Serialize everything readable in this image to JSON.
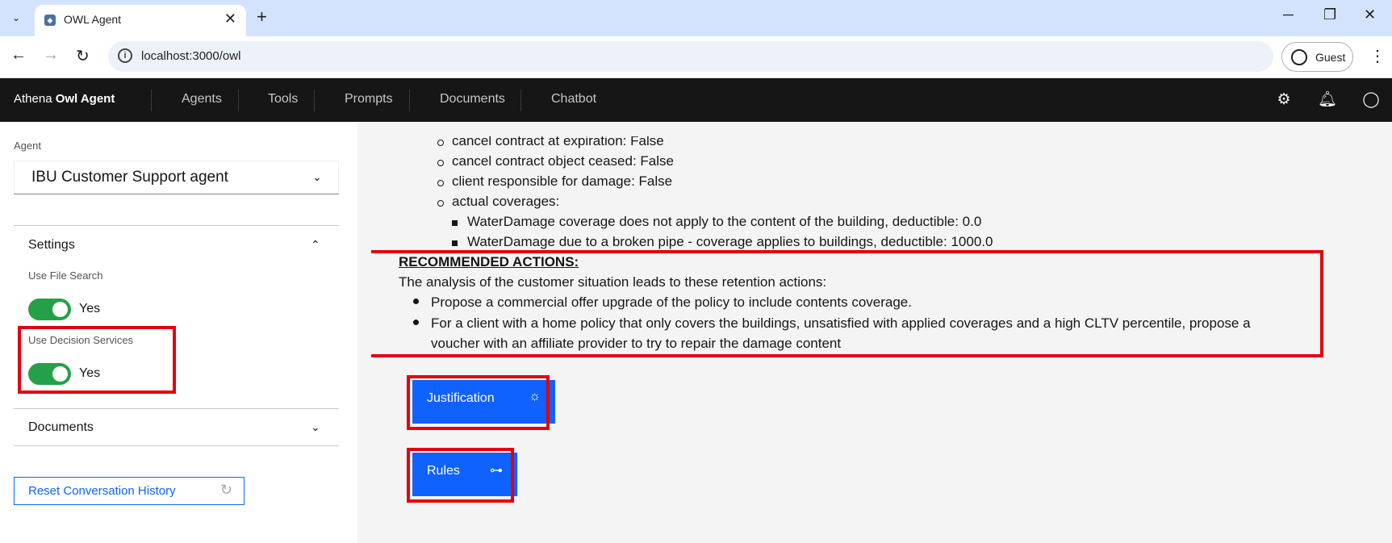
{
  "browser": {
    "tab_title": "OWL Agent",
    "url": "localhost:3000/owl",
    "profile_label": "Guest"
  },
  "header": {
    "brand_prefix": "Athena",
    "brand_bold": "Owl Agent",
    "nav": [
      "Agents",
      "Tools",
      "Prompts",
      "Documents",
      "Chatbot"
    ]
  },
  "sidebar": {
    "agent_label": "Agent",
    "agent_value": "IBU Customer Support agent",
    "settings_title": "Settings",
    "file_search_label": "Use File Search",
    "file_search_value": "Yes",
    "decision_services_label": "Use Decision Services",
    "decision_services_value": "Yes",
    "documents_title": "Documents",
    "reset_label": "Reset Conversation History"
  },
  "chat": {
    "bullets": [
      "cancel contract at expiration: False",
      "cancel contract object ceased: False",
      "client responsible for damage: False",
      "actual coverages:"
    ],
    "coverages": [
      "WaterDamage coverage does not apply to the content of the building, deductible: 0.0",
      "WaterDamage due to a broken pipe - coverage applies to buildings, deductible: 1000.0"
    ],
    "recommended_heading": "RECOMMENDED ACTIONS:",
    "recommended_intro": "The analysis of the customer situation leads to these retention actions:",
    "action_1": "Propose a commercial offer upgrade of the policy to include contents coverage.",
    "action_2_line1": "For a client with a home policy that only covers the buildings, unsatisfied with applied coverages and a high CLTV percentile, propose a",
    "action_2_line2": "voucher with an affiliate provider to try to repair the damage content",
    "justification_label": "Justification",
    "rules_label": "Rules"
  },
  "colors": {
    "accent": "#0f62fe",
    "toggle_on": "#24a148",
    "highlight": "#e3000f",
    "header_bg": "#161616"
  }
}
